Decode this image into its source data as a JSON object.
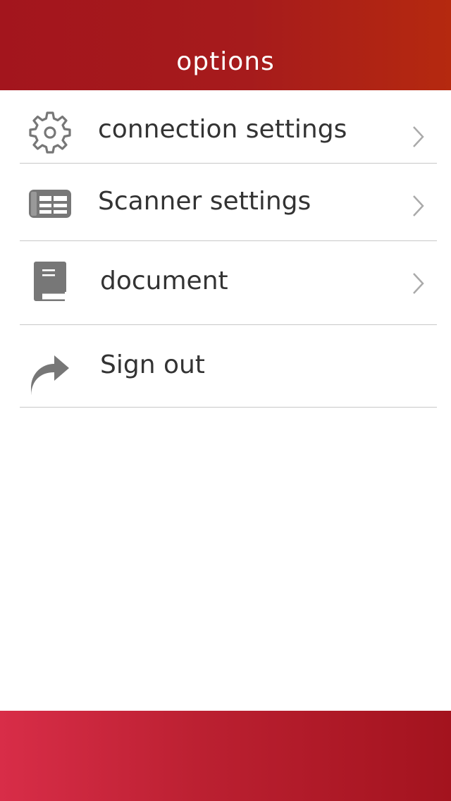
{
  "header": {
    "title": "options"
  },
  "menu": {
    "items": [
      {
        "label": "connection settings",
        "icon": "gear-icon",
        "has_chevron": true
      },
      {
        "label": "Scanner settings",
        "icon": "scanner-icon",
        "has_chevron": true
      },
      {
        "label": "document",
        "icon": "document-icon",
        "has_chevron": true
      },
      {
        "label": "Sign out",
        "icon": "sign-out-icon",
        "has_chevron": false
      }
    ]
  },
  "colors": {
    "header_start": "#a3151d",
    "header_end": "#b5290f",
    "footer_start": "#d82d48",
    "footer_end": "#a3131e",
    "icon_gray": "#777777",
    "text": "#333333",
    "chevron": "#aaaaaa",
    "divider": "#c8c8c8"
  }
}
